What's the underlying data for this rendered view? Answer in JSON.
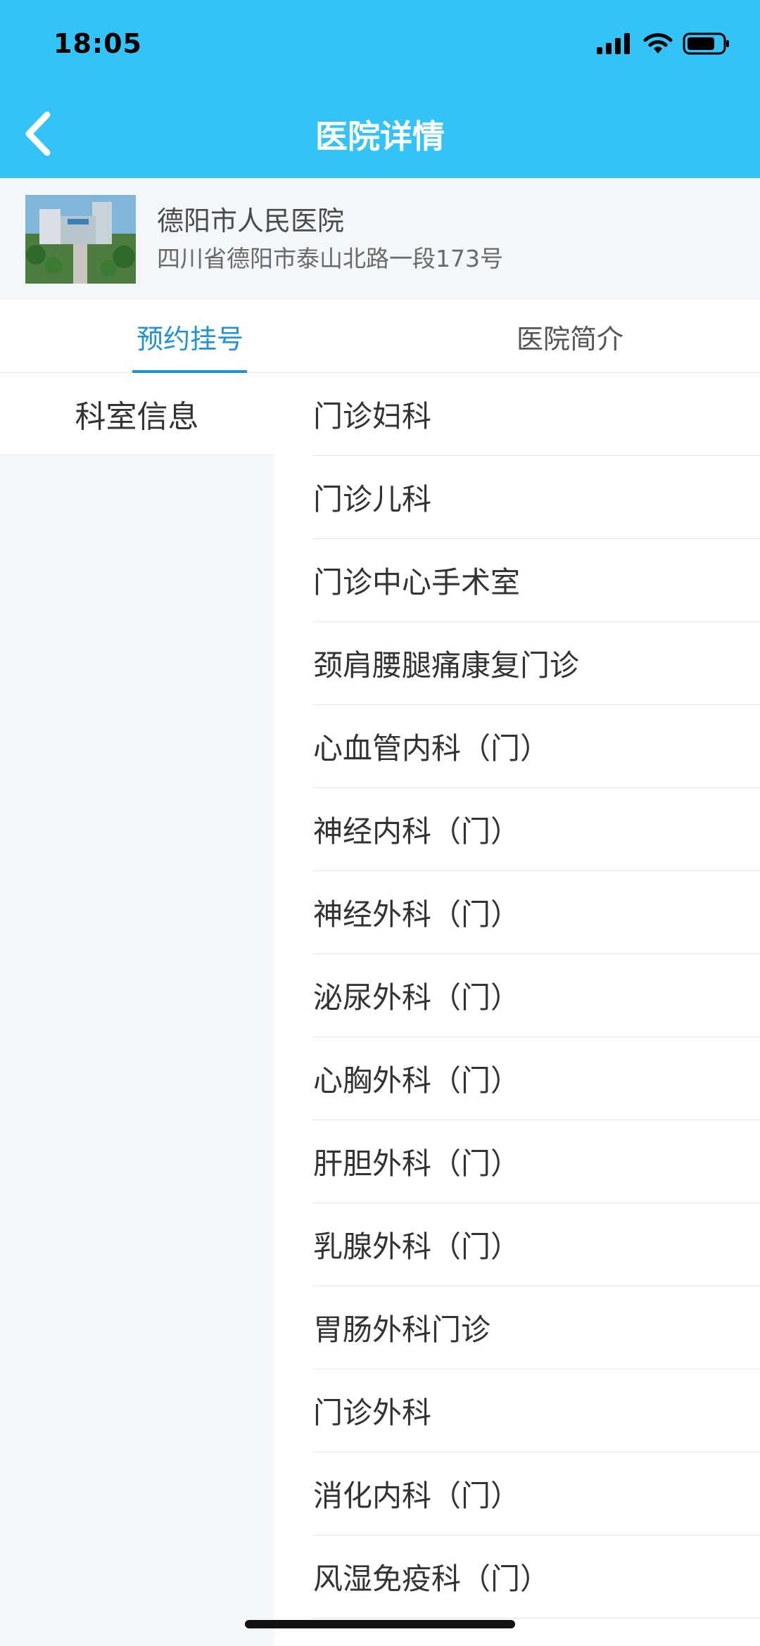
{
  "status_bar": {
    "time": "18:05"
  },
  "nav": {
    "title": "医院详情"
  },
  "hospital": {
    "name": "德阳市人民医院",
    "address": "四川省德阳市泰山北路一段173号"
  },
  "tabs": [
    {
      "label": "预约挂号",
      "active": true
    },
    {
      "label": "医院简介",
      "active": false
    }
  ],
  "sidebar": {
    "items": [
      {
        "label": "科室信息"
      }
    ]
  },
  "departments": [
    "门诊妇科",
    "门诊儿科",
    "门诊中心手术室",
    "颈肩腰腿痛康复门诊",
    "心血管内科（门）",
    "神经内科（门）",
    "神经外科（门）",
    "泌尿外科（门）",
    "心胸外科（门）",
    "肝胆外科（门）",
    "乳腺外科（门）",
    "胃肠外科门诊",
    "门诊外科",
    "消化内科（门）",
    "风湿免疫科（门）"
  ],
  "colors": {
    "header": "#33c3f6",
    "accent": "#1f93d3",
    "background": "#f3f7f9"
  },
  "icons": [
    "signal-icon",
    "wifi-icon",
    "battery-icon",
    "back-arrow-icon"
  ]
}
